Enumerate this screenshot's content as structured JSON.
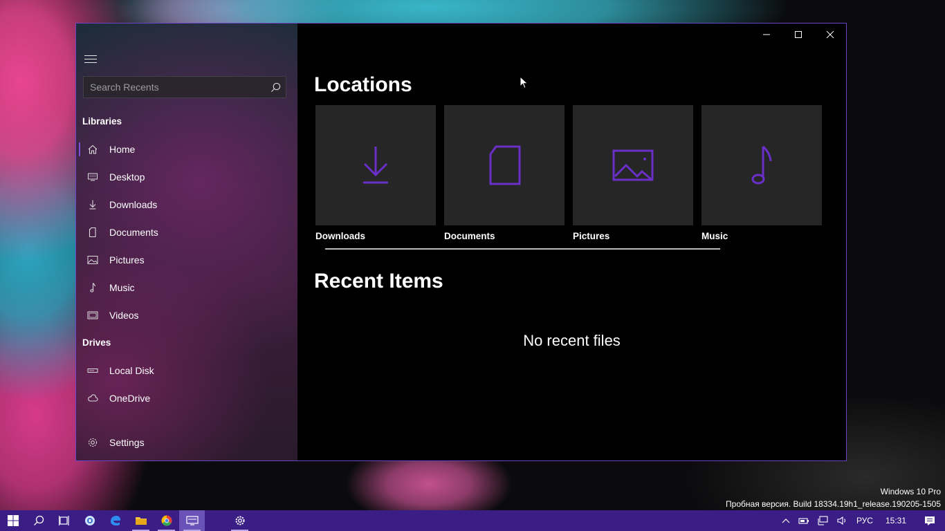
{
  "sidebar": {
    "search_placeholder": "Search Recents",
    "libraries_title": "Libraries",
    "drives_title": "Drives",
    "items": [
      {
        "label": "Home"
      },
      {
        "label": "Desktop"
      },
      {
        "label": "Downloads"
      },
      {
        "label": "Documents"
      },
      {
        "label": "Pictures"
      },
      {
        "label": "Music"
      },
      {
        "label": "Videos"
      }
    ],
    "drives": [
      {
        "label": "Local Disk"
      },
      {
        "label": "OneDrive"
      }
    ],
    "settings_label": "Settings"
  },
  "main": {
    "locations_title": "Locations",
    "tiles": [
      {
        "label": "Downloads",
        "icon": "download-icon"
      },
      {
        "label": "Documents",
        "icon": "document-icon"
      },
      {
        "label": "Pictures",
        "icon": "picture-icon"
      },
      {
        "label": "Music",
        "icon": "music-icon"
      }
    ],
    "recent_title": "Recent Items",
    "empty_text": "No recent files"
  },
  "desktop": {
    "watermark_line1": "Windows 10 Pro",
    "watermark_line2": "Пробная версия. Build 18334.19h1_release.190205-1505"
  },
  "taskbar": {
    "language": "РУС",
    "time": "15:31"
  },
  "colors": {
    "accent": "#6a2fc8",
    "taskbar": "#3a1e86",
    "tile": "#262626"
  }
}
